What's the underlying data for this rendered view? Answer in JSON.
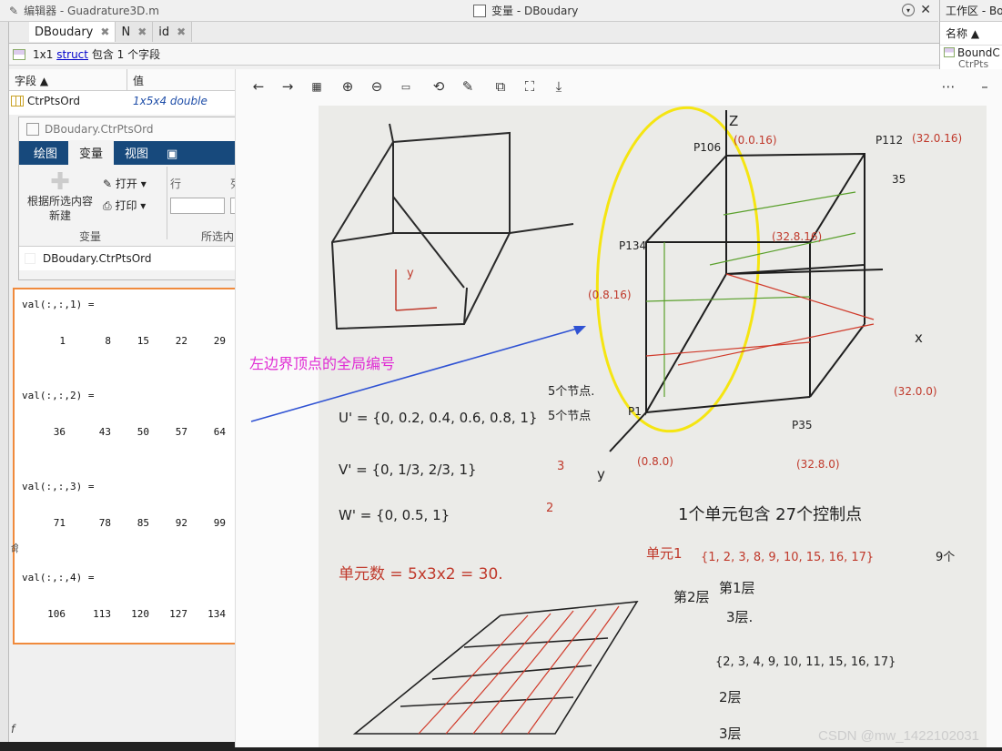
{
  "editor": {
    "title": "编辑器 - Guadrature3D.m"
  },
  "variables": {
    "title": "变量 - DBoudary",
    "tabs": [
      {
        "label": "DBoudary"
      },
      {
        "label": "N"
      },
      {
        "label": "id"
      }
    ],
    "struct_info": {
      "prefix": "1x1 ",
      "link": "struct",
      "suffix": " 包含 1 个字段"
    },
    "columns": {
      "field": "字段",
      "value": "值"
    },
    "row": {
      "name": "CtrPtsOrd",
      "value": "1x5x4 double"
    }
  },
  "workspace": {
    "title": "工作区 - Bo",
    "col": "名称",
    "item": "BoundC",
    "item2": "CtrPts"
  },
  "subwindow": {
    "title": "DBoudary.CtrPtsOrd",
    "ribbon_tabs": [
      "绘图",
      "变量",
      "视图"
    ],
    "new_from_selection": "根据所选内容\n新建",
    "open": "打开",
    "print": "打印",
    "row_label": "行",
    "col_label": "列",
    "group_variable": "变量",
    "group_selection": "所选内",
    "path": "DBoudary.CtrPtsOrd"
  },
  "output": {
    "blocks": [
      {
        "header": "val(:,:,1) =",
        "values": [
          "1",
          "8",
          "15",
          "22",
          "29"
        ]
      },
      {
        "header": "val(:,:,2) =",
        "values": [
          "36",
          "43",
          "50",
          "57",
          "64"
        ]
      },
      {
        "header": "val(:,:,3) =",
        "values": [
          "71",
          "78",
          "85",
          "92",
          "99"
        ]
      },
      {
        "header": "val(:,:,4) =",
        "values": [
          "106",
          "113",
          "120",
          "127",
          "134"
        ]
      }
    ]
  },
  "annotation": "左边界顶点的全局编号",
  "watermark": "CSDN @mw_1422102031",
  "left_labels": {
    "a": "命",
    "b": "f"
  },
  "notes": {
    "z": "Z",
    "x": "x",
    "y": "y",
    "p106": "P106",
    "c016": "(0.0.16)",
    "p112": "P112",
    "c32016": "(32.0.16)",
    "p134": "P134",
    "c0816": "(0.8.16)",
    "c32816": "(32.8.16)",
    "p1": "P1",
    "c080": "(0.8.0)",
    "p35": "P35",
    "c3280": "(32.8.0)",
    "c3200": "(32.0.0)",
    "nodes": "5个节点.",
    "u": "U' = {0, 0.2, 0.4, 0.6, 0.8, 1}",
    "u_n": "5个节点",
    "v": "V' = {0, 1/3, 2/3, 1}",
    "v_n": "3",
    "w": "W' = {0, 0.5, 1}",
    "w_n": "2",
    "elems": "单元数 = 5x3x2 = 30.",
    "ctrl": "1个单元包含 27个控制点",
    "e1": "单元1",
    "e1_set": "{1, 2, 3,  8, 9, 10,  15, 16, 17}",
    "e1_tag": "9个",
    "layer1": "第1层",
    "layer23": "第2层",
    "layer3": "3层.",
    "e2_set": "{2, 3, 4,  9, 10, 11,  15, 16, 17}",
    "layer2b": "2层",
    "layer3b": "3层",
    "n35": "35"
  }
}
